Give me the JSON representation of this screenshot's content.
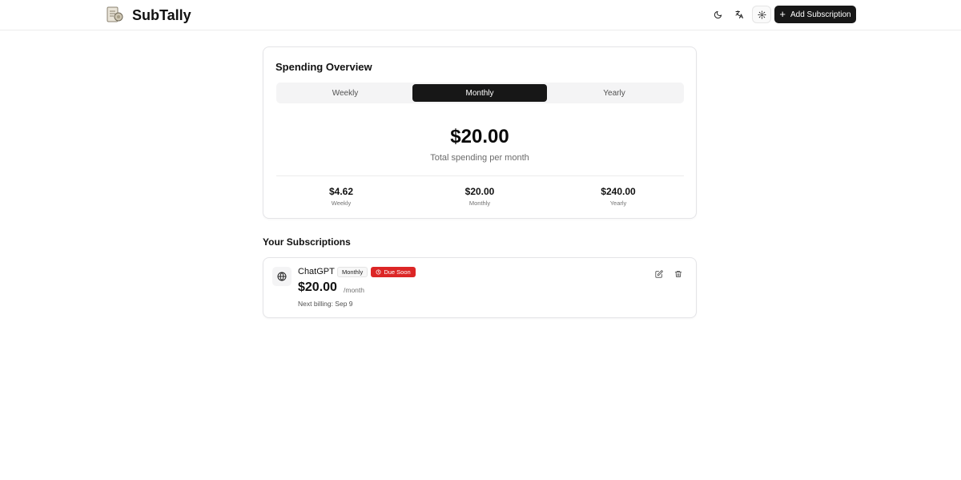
{
  "header": {
    "app_title": "SubTally",
    "add_button_label": "Add Subscription",
    "icons": [
      "moon-icon",
      "language-icon",
      "gear-icon",
      "plus-icon"
    ]
  },
  "overview": {
    "title": "Spending Overview",
    "tabs": [
      {
        "label": "Weekly",
        "active": false
      },
      {
        "label": "Monthly",
        "active": true
      },
      {
        "label": "Yearly",
        "active": false
      }
    ],
    "total_amount": "$20.00",
    "total_caption": "Total spending per month",
    "stats": [
      {
        "value": "$4.62",
        "label": "Weekly"
      },
      {
        "value": "$20.00",
        "label": "Monthly"
      },
      {
        "value": "$240.00",
        "label": "Yearly"
      }
    ]
  },
  "subscriptions": {
    "title": "Your Subscriptions",
    "items": [
      {
        "name": "ChatGPT",
        "cycle": "Monthly",
        "status": "Due Soon",
        "price": "$20.00",
        "period": "/month",
        "next_billing": "Next billing: Sep 9",
        "icon": "globe-icon"
      }
    ]
  },
  "colors": {
    "primary": "#171717",
    "due_soon": "#dc2626",
    "muted_text": "#737373",
    "border": "#e4e4e7"
  }
}
